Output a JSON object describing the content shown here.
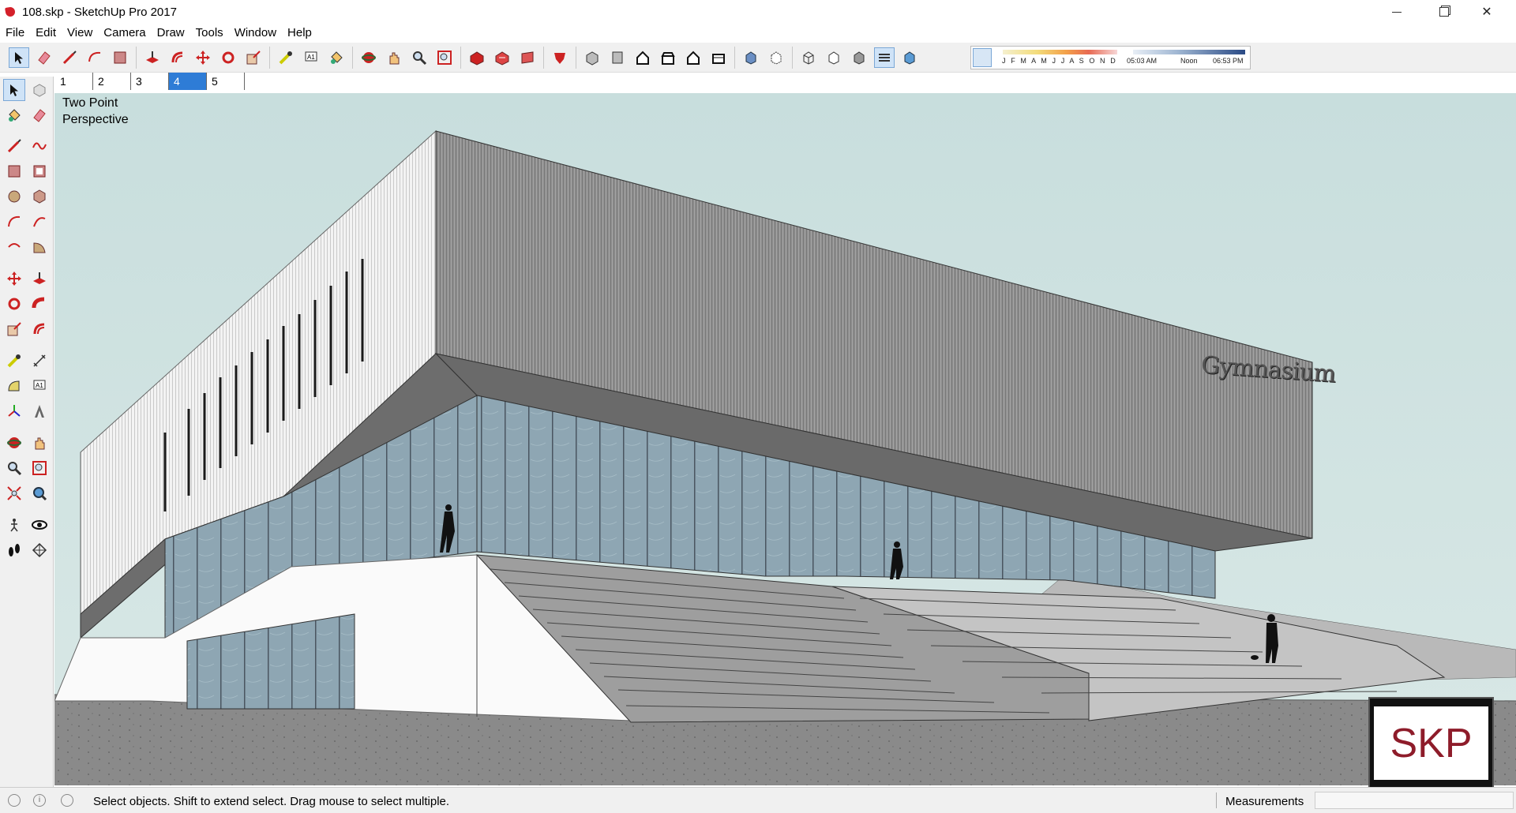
{
  "window": {
    "title": "108.skp - SketchUp Pro 2017",
    "controls": {
      "minimize": "minimize-icon",
      "maximize": "maximize-icon",
      "close": "close-icon"
    }
  },
  "menu": [
    "File",
    "Edit",
    "View",
    "Camera",
    "Draw",
    "Tools",
    "Window",
    "Help"
  ],
  "toolbar": {
    "icons": [
      "select",
      "eraser",
      "line",
      "arc",
      "shapes",
      "push-pull",
      "offset",
      "move",
      "rotate",
      "scale",
      "tape-measure",
      "text",
      "paint-bucket",
      "orbit",
      "pan",
      "zoom",
      "zoom-extents",
      "3d-warehouse",
      "extension-warehouse",
      "layout",
      "extension-manager",
      "iso-view",
      "top-view",
      "front-view",
      "right-view",
      "back-view",
      "left-view",
      "xray",
      "back-edges",
      "wireframe",
      "hidden-line",
      "shaded",
      "shaded-with-textures",
      "monochrome"
    ],
    "shadows": {
      "months": "J F M A M J J A S O N D",
      "time_start": "05:03 AM",
      "time_noon": "Noon",
      "time_end": "06:53 PM"
    }
  },
  "scenes": {
    "tabs": [
      "1",
      "2",
      "3",
      "4",
      "5"
    ],
    "active_index": 3
  },
  "left_tools": [
    "select",
    "make-component",
    "paint-bucket",
    "eraser",
    "line",
    "freehand",
    "rectangle",
    "rotated-rectangle",
    "circle",
    "polygon",
    "arc",
    "two-point-arc",
    "three-point-arc",
    "pie",
    "move",
    "push-pull",
    "rotate",
    "follow-me",
    "scale",
    "offset",
    "tape-measure",
    "dimension",
    "protractor",
    "text",
    "axes",
    "3d-text",
    "orbit",
    "pan",
    "zoom",
    "zoom-window",
    "zoom-extents",
    "previous-view",
    "position-camera",
    "look-around",
    "walk",
    "section-plane"
  ],
  "viewport": {
    "camera_label": "Two Point Perspective",
    "sign_text": "Gymnasium",
    "logo_text": "SKP",
    "colors": {
      "sky": "#cfe3e2",
      "facade": "#909090",
      "glass": "#8fa7b4",
      "ground": "#8c8c8c"
    }
  },
  "status": {
    "hint": "Select objects. Shift to extend select. Drag mouse to select multiple.",
    "measurements_label": "Measurements",
    "measurements_value": ""
  }
}
